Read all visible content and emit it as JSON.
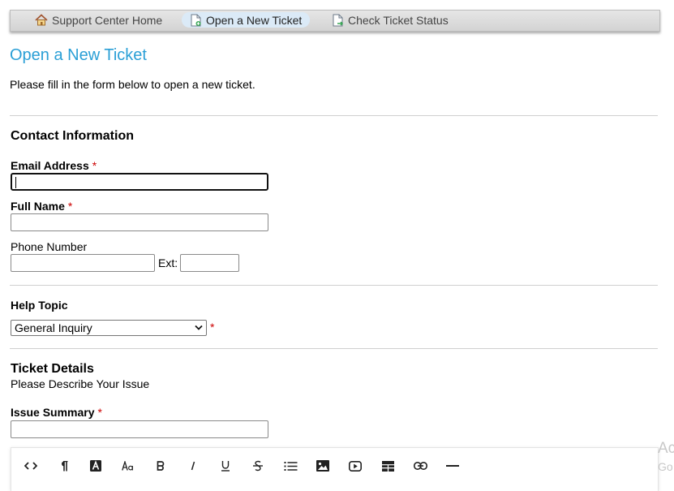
{
  "nav": {
    "home_label": "Support Center Home",
    "open_label": "Open a New Ticket",
    "check_label": "Check Ticket Status"
  },
  "page": {
    "title": "Open a New Ticket",
    "intro": "Please fill in the form below to open a new ticket."
  },
  "contact": {
    "heading": "Contact Information",
    "email_label": "Email Address",
    "email_value": "",
    "fullname_label": "Full Name",
    "fullname_value": "",
    "phone_label": "Phone Number",
    "phone_value": "",
    "ext_label": "Ext:",
    "ext_value": "",
    "required_mark": "*"
  },
  "help_topic": {
    "label": "Help Topic",
    "selected": "General Inquiry",
    "required_mark": "*"
  },
  "ticket": {
    "heading": "Ticket Details",
    "subheading": "Please Describe Your Issue",
    "summary_label": "Issue Summary",
    "summary_value": "",
    "required_mark": "*"
  },
  "editor_toolbar": {
    "buttons": [
      "code-view",
      "paragraph",
      "text-color",
      "font-size",
      "bold",
      "italic",
      "underline",
      "strikethrough",
      "unordered-list",
      "image",
      "video",
      "table",
      "link",
      "horizontal-rule"
    ]
  },
  "watermark": {
    "line1": "Ac",
    "line2": "Go"
  },
  "colors": {
    "title": "#2a9fd6",
    "required": "#cc0000",
    "active_tab": "#dbeaf7"
  }
}
